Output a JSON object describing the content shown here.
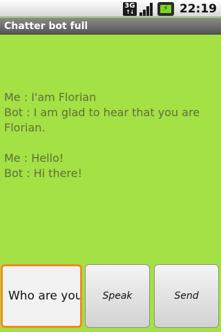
{
  "status_bar": {
    "network_label": "3G",
    "time": "22:19"
  },
  "app": {
    "title": "Chatter bot full",
    "background_color": "#a3e144"
  },
  "conversation": {
    "exchanges": [
      {
        "user": "Me : I'am Florian",
        "bot": "Bot : I am glad to hear that you are Florian."
      },
      {
        "user": "Me : Hello!",
        "bot": "Bot : Hi there!"
      }
    ]
  },
  "input": {
    "value": "Who are you?"
  },
  "buttons": {
    "speak_label": "Speak",
    "send_label": "Send"
  },
  "icons": {
    "network": "3g-icon",
    "signal": "signal-icon",
    "battery": "battery-charging-icon"
  }
}
